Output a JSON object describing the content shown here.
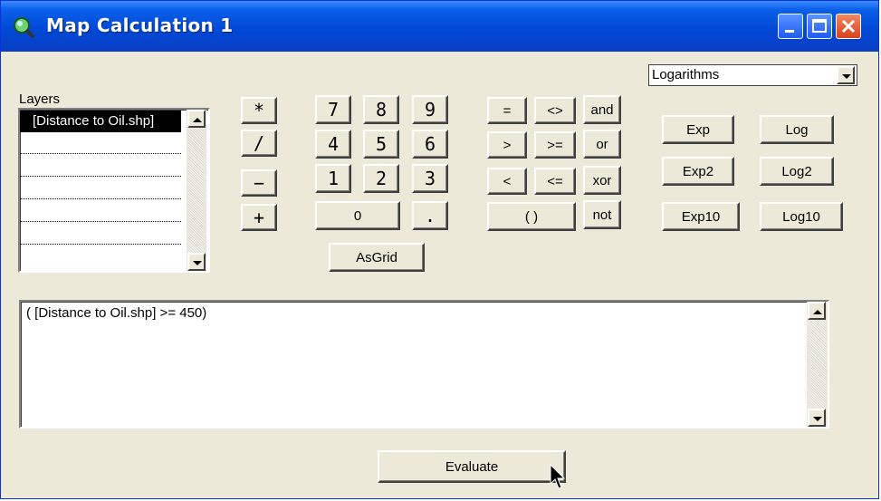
{
  "window": {
    "title": "Map Calculation 1",
    "buttons": {
      "minimize": "minimize-icon",
      "maximize": "maximize-icon",
      "close": "close-icon"
    }
  },
  "layers": {
    "label": "Layers",
    "items": [
      "[Distance to Oil.shp]",
      "",
      "",
      "",
      "",
      ""
    ],
    "selected_index": 0
  },
  "operators": {
    "multiply": "*",
    "divide": "/",
    "subtract": "−",
    "add": "+",
    "digits": [
      "7",
      "8",
      "9",
      "4",
      "5",
      "6",
      "1",
      "2",
      "3"
    ],
    "zero": "0",
    "decimal": ".",
    "asgrid": "AsGrid",
    "equal": "=",
    "not_equal": "<>",
    "and": "and",
    "greater": ">",
    "greater_equal": ">=",
    "or": "or",
    "less": "<",
    "less_equal": "<=",
    "xor": "xor",
    "parens": "( )",
    "not": "not"
  },
  "function_category": {
    "selected": "Logarithms"
  },
  "functions": {
    "exp": "Exp",
    "log": "Log",
    "exp2": "Exp2",
    "log2": "Log2",
    "exp10": "Exp10",
    "log10": "Log10"
  },
  "expression": {
    "value": "( [Distance to Oil.shp] >= 450)"
  },
  "evaluate_label": "Evaluate",
  "colors": {
    "titlebar": "#0047d5",
    "face": "#ece9d8",
    "selection": "#000000"
  }
}
